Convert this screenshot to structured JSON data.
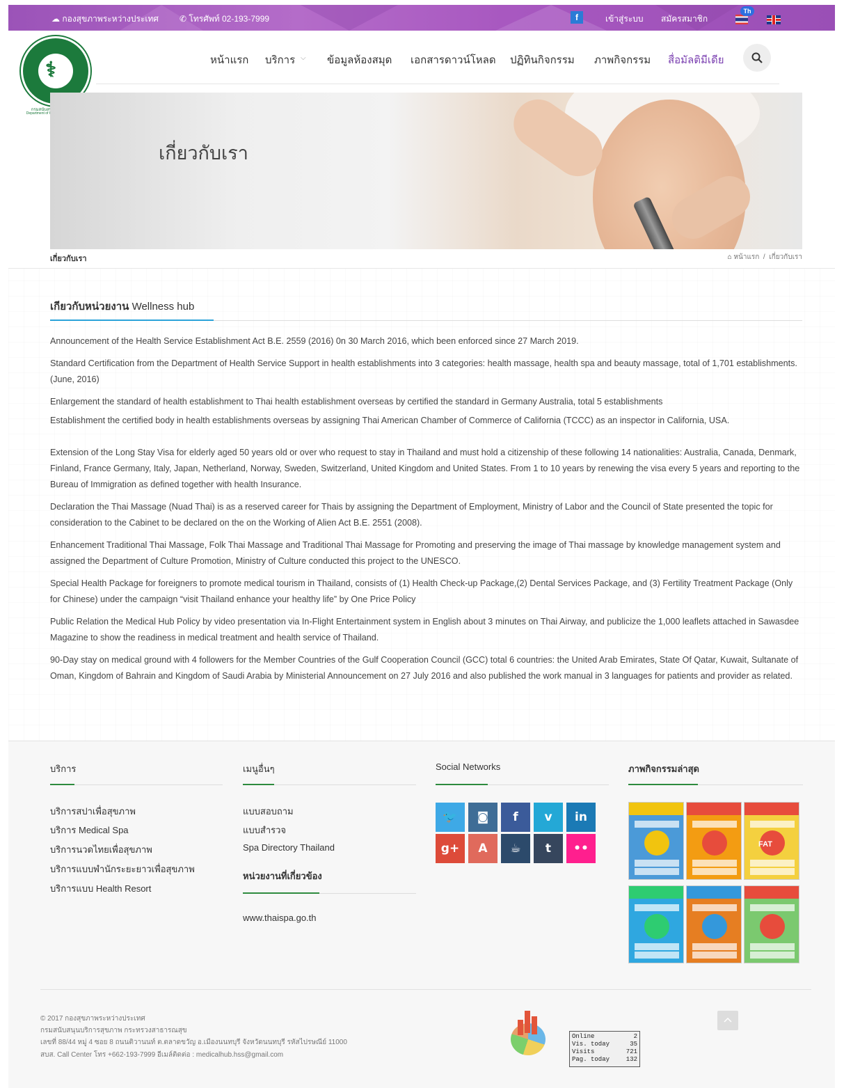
{
  "topbar": {
    "org": "กองสุขภาพระหว่างประเทศ",
    "phone": "โทรศัพท์ 02-193-7999",
    "facebook": "f",
    "login": "เข้าสู่ระบบ",
    "register": "สมัครสมาชิก",
    "lang_badge": "Th",
    "bg_color": "#a95fc1"
  },
  "logo": {
    "ring_text": "กระทรวงสาธารณสุข / MINISTRY OF PUBLIC HEALTH",
    "caption_th": "กรมสนับสนุนบริการสุขภาพ",
    "caption_en": "Department of Health Service Support"
  },
  "nav": {
    "items": [
      "หน้าแรก",
      "บริการ",
      "ข้อมูลห้องสมุด",
      "เอกสารดาวน์โหลด",
      "ปฏิทินกิจกรรม",
      "ภาพกิจกรรม",
      "สื่อมัลติมีเดีย"
    ],
    "active": "สื่อมัลติมีเดีย",
    "active_color": "#7a3fb0"
  },
  "banner": {
    "title": "เกี่ยวกับเรา"
  },
  "breadcrumb": {
    "page": "เกี่ยวกับเรา",
    "home": "หน้าแรก",
    "separator": "/",
    "current": "เกี่ยวกับเรา"
  },
  "section": {
    "title_th": "เกียวกับหน่วยงาน",
    "title_en": "Wellness hub",
    "accent_color": "#2aa3d9",
    "paragraphs": [
      "Announcement of the Health Service Establishment Act B.E. 2559 (2016) 0n 30 March 2016, which been enforced since 27 March 2019.",
      "Standard Certification from the Department of Health Service Support in health establishments into 3 categories: health massage, health spa and beauty massage, total of 1,701 establishments. (June, 2016)",
      "Enlargement the standard of health establishment to Thai health establishment overseas by certified the standard in Germany Australia, total 5 establishments",
      "Establishment the certified body in health establishments overseas by assigning Thai American Chamber of Commerce of California (TCCC) as an inspector in California, USA.",
      "Extension of the Long Stay Visa for elderly aged 50 years old or over who request to stay in Thailand and must hold a citizenship of these following 14 nationalities: Australia, Canada, Denmark, Finland, France Germany, Italy, Japan, Netherland, Norway, Sweden, Switzerland, United Kingdom and United States. From 1 to 10 years by renewing the visa every 5 years and reporting to the Bureau of Immigration as defined together with health Insurance.",
      "Declaration the Thai Massage (Nuad Thai) is as a reserved career for Thais by assigning the Department of Employment, Ministry of Labor and the Council of State presented the topic for consideration to the Cabinet to be declared on the on the Working of Alien Act B.E. 2551 (2008).",
      "Enhancement Traditional Thai Massage, Folk Thai Massage and Traditional Thai Massage for Promoting and preserving the image of Thai massage by knowledge management system and assigned the Department of Culture Promotion, Ministry of Culture conducted this project to the UNESCO.",
      "Special Health Package for foreigners to promote medical tourism in Thailand, consists of (1) Health Check-up Package,(2) Dental Services Package, and (3) Fertility Treatment Package (Only for Chinese) under the campaign “visit Thailand enhance your healthy life” by One Price Policy",
      "Public Relation the Medical Hub Policy by video presentation via In-Flight Entertainment system in English about 3 minutes on Thai Airway, and publicize the 1,000 leaflets attached in Sawasdee Magazine to show the readiness in medical treatment and health service of Thailand.",
      "90-Day stay on medical ground with 4 followers for the Member Countries of the Gulf Cooperation Council (GCC) total 6 countries: the United Arab Emirates, State Of Qatar, Kuwait, Sultanate of Oman, Kingdom of Bahrain and Kingdom of Saudi Arabia by Ministerial Announcement on 27 July 2016 and also published the work manual in 3 languages for patients and provider as related."
    ]
  },
  "footer": {
    "services": {
      "title": "บริการ",
      "links": [
        "บริการสปาเพื่อสุขภาพ",
        "บริการ Medical Spa",
        "บริการนวดไทยเพื่อสุขภาพ",
        "บริการแบบพำนักระยะยาวเพื่อสุขภาพ",
        "บริการแบบ Health Resort"
      ]
    },
    "other": {
      "title": "เมนูอื่นๆ",
      "links": [
        "แบบสอบถาม",
        "แบบสำรวจ",
        "Spa Directory Thailand"
      ],
      "related_title": "หน่วยงานที่เกี่ยวข้อง",
      "related_links": [
        "www.thaispa.go.th"
      ]
    },
    "social": {
      "title": "Social Networks",
      "icons": [
        {
          "name": "twitter",
          "glyph": "🐦",
          "color": "#3ea9e6"
        },
        {
          "name": "instagram",
          "glyph": "◙",
          "color": "#3f6d96"
        },
        {
          "name": "facebook",
          "glyph": "f",
          "color": "#3b5b9a"
        },
        {
          "name": "vimeo",
          "glyph": "v",
          "color": "#24a8d6"
        },
        {
          "name": "linkedin",
          "glyph": "in",
          "color": "#1b7ab5"
        },
        {
          "name": "google-plus",
          "glyph": "g+",
          "color": "#dd4b39"
        },
        {
          "name": "app-store",
          "glyph": "A",
          "color": "#e06a5c"
        },
        {
          "name": "dropbox-cup",
          "glyph": "☕",
          "color": "#2c4a6b"
        },
        {
          "name": "tumblr",
          "glyph": "t",
          "color": "#36465d"
        },
        {
          "name": "flickr",
          "glyph": "••",
          "color": "#ff1f8e"
        }
      ]
    },
    "gallery": {
      "title": "ภาพกิจกรรมล่าสุด",
      "thumbs": [
        {
          "bg": "#4b9ad8",
          "accent": "#f1c40f",
          "label": ""
        },
        {
          "bg": "#f39c12",
          "accent": "#e74c3c",
          "label": ""
        },
        {
          "bg": "#f4d03f",
          "accent": "#e74c3c",
          "label": "FAT"
        },
        {
          "bg": "#2fa7e0",
          "accent": "#2ecc71",
          "label": ""
        },
        {
          "bg": "#e67e22",
          "accent": "#3498db",
          "label": ""
        },
        {
          "bg": "#7bc96f",
          "accent": "#e74c3c",
          "label": ""
        }
      ]
    },
    "copyright": [
      "© 2017 กองสุขภาพระหว่างประเทศ",
      "กรมสนับสนุนบริการสุขภาพ กระทรวงสาธารณสุข",
      "เลขที่ 88/44 หมู่ 4 ซอย 8 ถนนติวานนท์ ต.ตลาดขวัญ อ.เมืองนนทบุรี จังหวัดนนทบุรี รหัสไปรษณีย์ 11000",
      "สบส. Call Center โทร +662-193-7999 อีเมล์ติดต่อ : medicalhub.hss@gmail.com"
    ],
    "stats": [
      {
        "label": "Online",
        "value": "2"
      },
      {
        "label": "Vis. today",
        "value": "35"
      },
      {
        "label": "Visits",
        "value": "721"
      },
      {
        "label": "Pag. today",
        "value": "132"
      }
    ]
  }
}
